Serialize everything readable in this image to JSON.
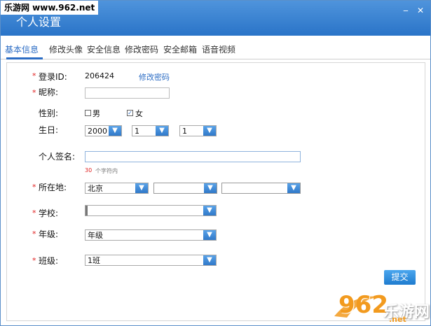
{
  "site_tag": "乐游网 www.962.net",
  "window": {
    "title": "个人设置",
    "minimize_icon": "minimize-icon",
    "close_icon": "close-icon"
  },
  "tabs": [
    {
      "label": "基本信息",
      "active": true
    },
    {
      "label": "修改头像",
      "active": false
    },
    {
      "label": "安全信息",
      "active": false
    },
    {
      "label": "修改密码",
      "active": false
    },
    {
      "label": "安全邮箱",
      "active": false
    },
    {
      "label": "语音视频",
      "active": false
    }
  ],
  "form": {
    "required_mark": "*",
    "login_id": {
      "label": "登录ID:",
      "value": "206424",
      "link": "修改密码"
    },
    "nickname": {
      "label": "昵称:",
      "value": ""
    },
    "gender": {
      "label": "性别:",
      "male": "男",
      "female": "女",
      "selected": "女",
      "checked_mark": "☑",
      "unchecked_mark": "☐"
    },
    "birthday": {
      "label": "生日:",
      "year": "2000",
      "month": "1",
      "day": "1"
    },
    "signature": {
      "label": "个人签名:",
      "value": "",
      "hint_count": "30",
      "hint_text": "个字符内"
    },
    "location": {
      "label": "所在地:",
      "province": "北京",
      "city": "",
      "district": ""
    },
    "school": {
      "label": "学校:",
      "value": ""
    },
    "grade": {
      "label": "年级:",
      "value": "年级"
    },
    "class": {
      "label": "班级:",
      "value": "1班"
    },
    "submit_label": "提交"
  },
  "watermark": {
    "digits": "962",
    "suffix": ".net",
    "brand": "乐游网"
  },
  "colors": {
    "title_bar": "#3a86d4",
    "accent": "#2b6cc4",
    "required": "#e02020",
    "watermark_orange": "#f29a1e"
  }
}
